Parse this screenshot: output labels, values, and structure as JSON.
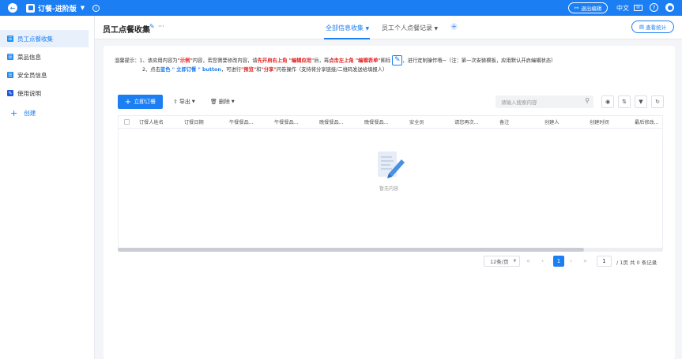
{
  "topbar": {
    "app_title": "订餐-进阶版",
    "exit_edit": "退出编辑",
    "language": "中文",
    "icons": [
      "back-icon",
      "app-icon",
      "caret-down-icon",
      "info-icon",
      "mail-icon",
      "help-icon",
      "avatar-icon"
    ]
  },
  "sidebar": {
    "items": [
      {
        "label": "员工点餐收集",
        "active": true
      },
      {
        "label": "菜品信息",
        "active": false
      },
      {
        "label": "安全员信息",
        "active": false
      },
      {
        "label": "使用说明",
        "active": false
      }
    ],
    "create_label": "创建"
  },
  "header": {
    "page_title": "员工点餐收集",
    "more": "···",
    "tabs": [
      {
        "label": "全部信息收集",
        "active": true
      },
      {
        "label": "员工个人点餐记录",
        "active": false
      }
    ],
    "view_stats": "查看统计"
  },
  "tip": {
    "prefix": "温馨提示：",
    "l1_a": "1、该应用内容为",
    "l1_b": "\"示例\"",
    "l1_c": "内容，若您需要修改内容，请",
    "l1_d": "先开启右上角 \"编辑应用\"",
    "l1_e": "后，再",
    "l1_f": "点击左上角 \"编辑表单\"",
    "l1_g": "图标",
    "l1_h": "，进行定制操作哦~（注：第一次安装模板，应用默认开启编辑状态）",
    "l2_a": "2、点击",
    "l2_b": "蓝色 \" 立即订餐 \" button",
    "l2_c": "，可进行",
    "l2_d": "\"预览\"",
    "l2_e": "和",
    "l2_f": "\"分享\"",
    "l2_g": "问卷操作（支持将分享链接/二维码发送给填报人）"
  },
  "toolbar": {
    "order_now": "立即订餐",
    "export": "导出",
    "delete": "删除",
    "search_placeholder": "请输入搜索内容"
  },
  "table": {
    "columns": [
      "订餐人姓名",
      "订餐日期",
      "午餐餐品...",
      "午餐餐品...",
      "晚餐餐品...",
      "晚餐餐品...",
      "安全员",
      "请您再次...",
      "备注",
      "创建人",
      "创建时间",
      "最后修改..."
    ],
    "empty_text": "暂无内容"
  },
  "pagination": {
    "page_size": "12条/页",
    "current_page": "1",
    "jump_value": "1",
    "total_pages": "/ 1页",
    "total_records": "共 0 条记录"
  }
}
